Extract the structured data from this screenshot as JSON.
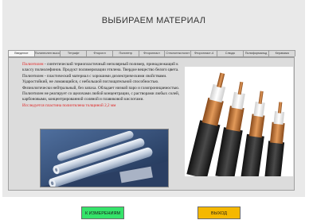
{
  "header": {
    "title": "ВЫБИРАЕМ МАТЕРИАЛ"
  },
  "tabs": [
    {
      "label": "Введение",
      "active": true
    },
    {
      "label": "Полиэтилен высокого",
      "active": false
    },
    {
      "label": "Тетрафт",
      "active": false
    },
    {
      "label": "Фторопл",
      "active": false
    },
    {
      "label": "Политетр",
      "active": false
    },
    {
      "label": "Фторопласт",
      "active": false
    },
    {
      "label": "Стеклотекстолит",
      "active": false
    },
    {
      "label": "Фторопласт-4",
      "active": false
    },
    {
      "label": "Слюда",
      "active": false
    },
    {
      "label": "Полиформальд",
      "active": false
    },
    {
      "label": "Керамика",
      "active": false
    }
  ],
  "content": {
    "paragraph_lead": "Полиэтилен",
    "paragraph_rest": " - синтетический термопластичный неполярный полимер, принадлежащий к классу полиолефинов. Продукт полимеризации этилена. Твердое вещество белого цвета. Полиэтилен - пластический материал с хорошими диэлектрическими свойствами. Ударостойкий, не ломающийся, с небольшой поглощательной способностью. Физиологически нейтральный, без запаха. Обладает низкой паро и газопроницаемостью. Полиэтилен не реагирует со щелочами любой концентрации, с растворами любых солей, карбоновыми, концентрированной соляной и плавиковой кислотами.",
    "warning": "Исследуется пластина полиэтилена толщиной 2,2 мм"
  },
  "images": {
    "left": "plastic-film-rolls-photo",
    "right": "coaxial-cable-cross-sections-photo"
  },
  "buttons": {
    "measure": "К ИЗМЕРЕНИЯМ",
    "exit": "ВЫХОД"
  },
  "colors": {
    "window_bg": "#e9e9e9",
    "highlight_red": "#e02020",
    "measure_green": "#35e36a",
    "exit_orange": "#f5b800"
  }
}
